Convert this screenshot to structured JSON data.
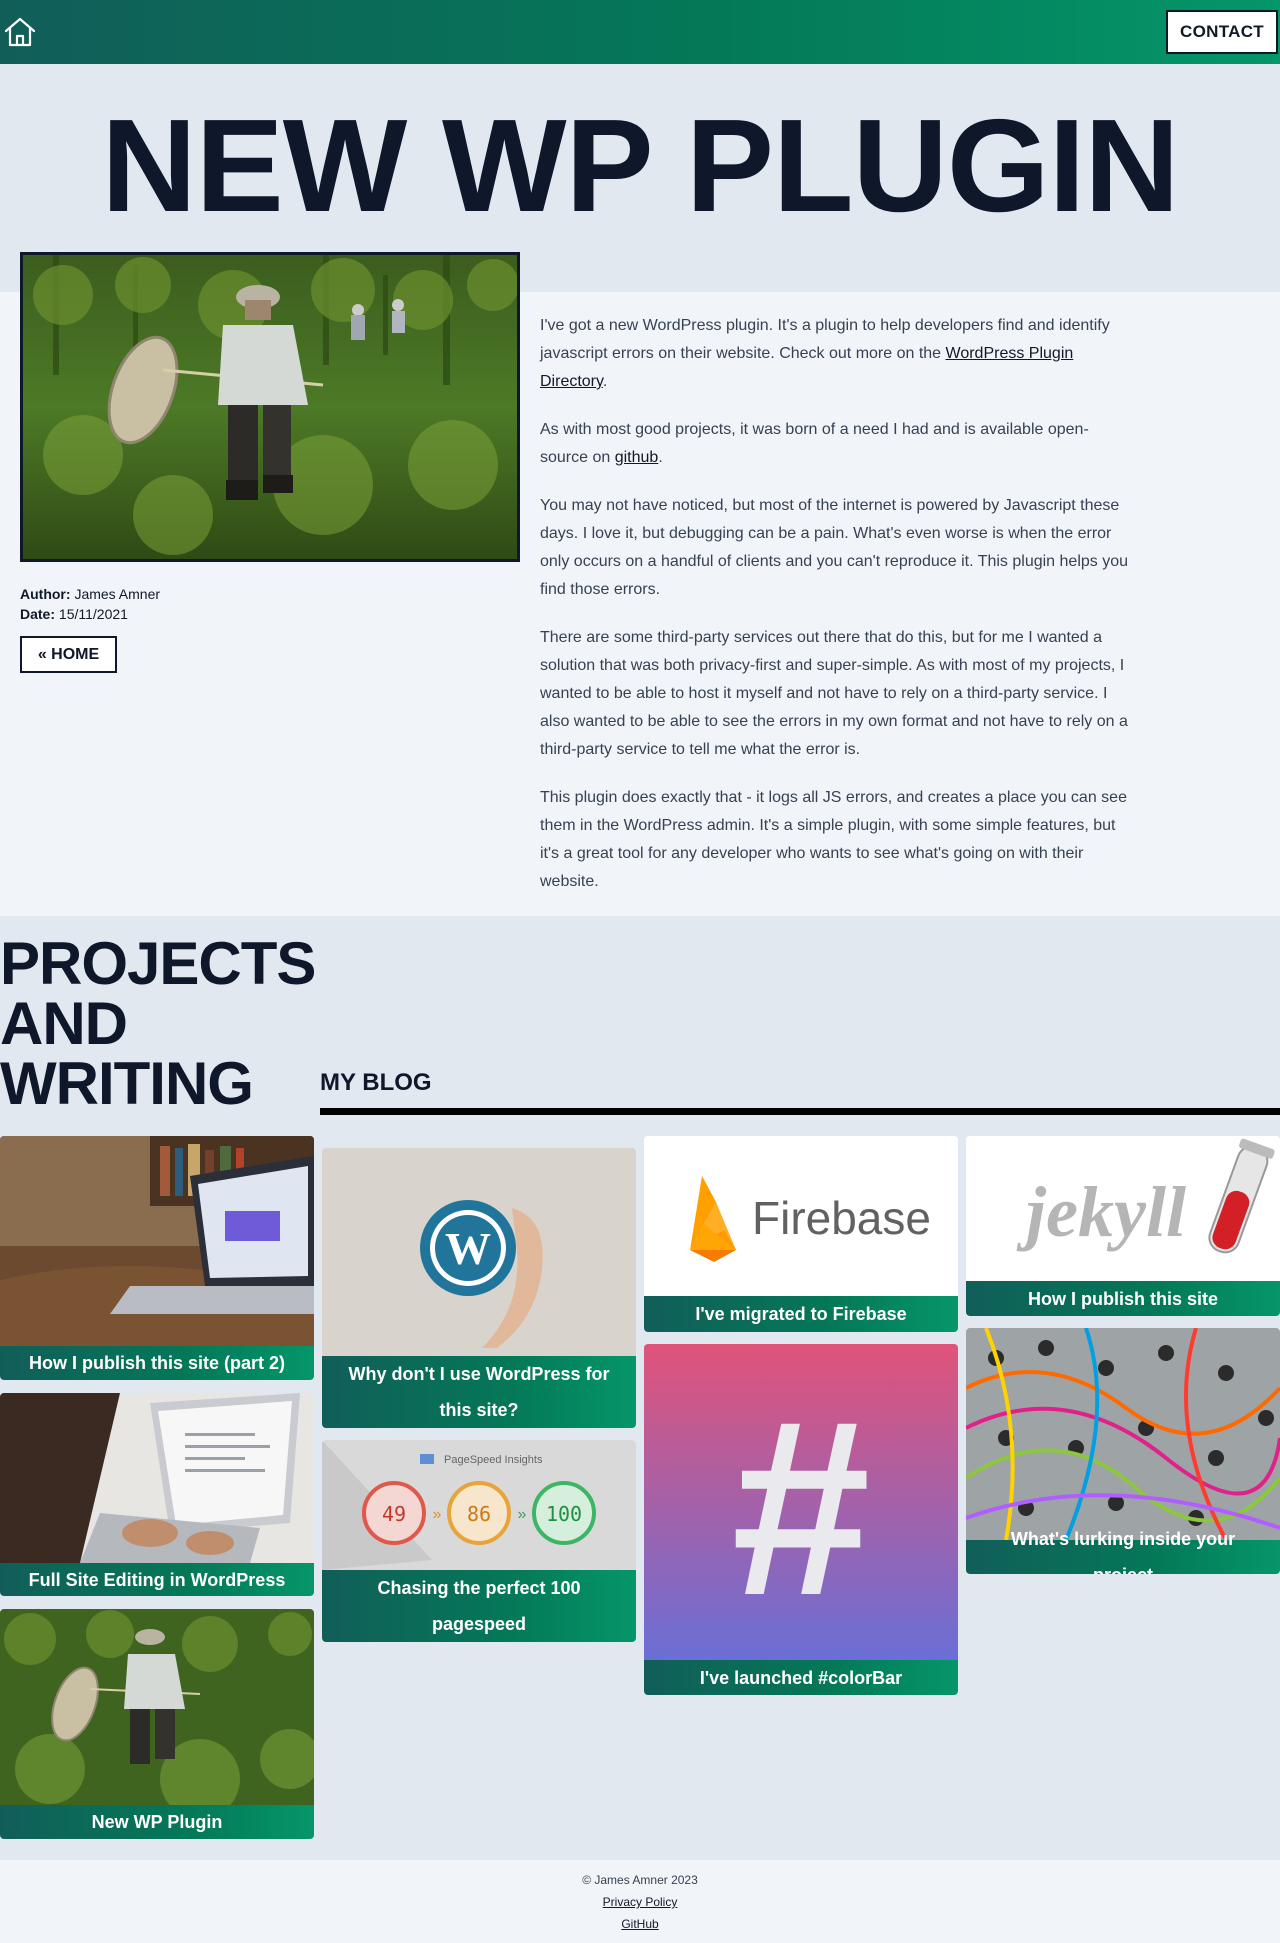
{
  "header": {
    "home_icon": "home-icon",
    "contact_label": "CONTACT",
    "gradient_colors": [
      "#115e59",
      "#059669"
    ]
  },
  "hero": {
    "title": "NEW WP PLUGIN"
  },
  "article": {
    "image_alt": "Person with butterfly net in a grassy field",
    "author_label": "Author:",
    "author": "James Amner",
    "date_label": "Date:",
    "date": "15/11/2021",
    "home_button": "« HOME",
    "p1_before": "I've got a new WordPress plugin. It's a plugin to help developers find and identify javascript errors on their website. Check out more on the ",
    "p1_link": "WordPress Plugin Directory",
    "p1_after": ".",
    "p2_before": "As with most good projects, it was born of a need I had and is available open-source on ",
    "p2_link": "github",
    "p2_after": ".",
    "p3": "You may not have noticed, but most of the internet is powered by Javascript these days. I love it, but debugging can be a pain. What's even worse is when the error only occurs on a handful of clients and you can't reproduce it. This plugin helps you find those errors.",
    "p4": "There are some third-party services out there that do this, but for me I wanted a solution that was both privacy-first and super-simple. As with most of my projects, I wanted to be able to host it myself and not have to rely on a third-party service. I also wanted to be able to see the errors in my own format and not have to rely on a third-party service to tell me what the error is.",
    "p5": "This plugin does exactly that - it logs all JS errors, and creates a place you can see them in the WordPress admin. It's a simple plugin, with some simple features, but it's a great tool for any developer who wants to see what's going on with their website."
  },
  "projects": {
    "title_line1": "PROJECTS",
    "title_line2": "AND",
    "title_line3": "WRITING",
    "blog_heading": "MY BLOG",
    "cards": {
      "publish2": "How I publish this site (part 2)",
      "fse": "Full Site Editing in WordPress",
      "wpplugin": "New WP Plugin",
      "whynowp": "Why don't I use WordPress for this site?",
      "pagespeed": "Chasing the perfect 100 pagespeed",
      "firebase": "I've migrated to Firebase",
      "colorbar": "I've launched #colorBar",
      "publish": "How I publish this site",
      "lurking": "What's lurking inside your project"
    },
    "firebase_logo_text": "Firebase",
    "jekyll_logo_text": "jekyll",
    "pagespeed_header": "PageSpeed Insights",
    "pagespeed_scores": [
      "49",
      "86",
      "100"
    ],
    "hash_symbol": "#"
  },
  "footer": {
    "copyright": "© James Amner 2023",
    "privacy": "Privacy Policy",
    "github": "GitHub"
  }
}
